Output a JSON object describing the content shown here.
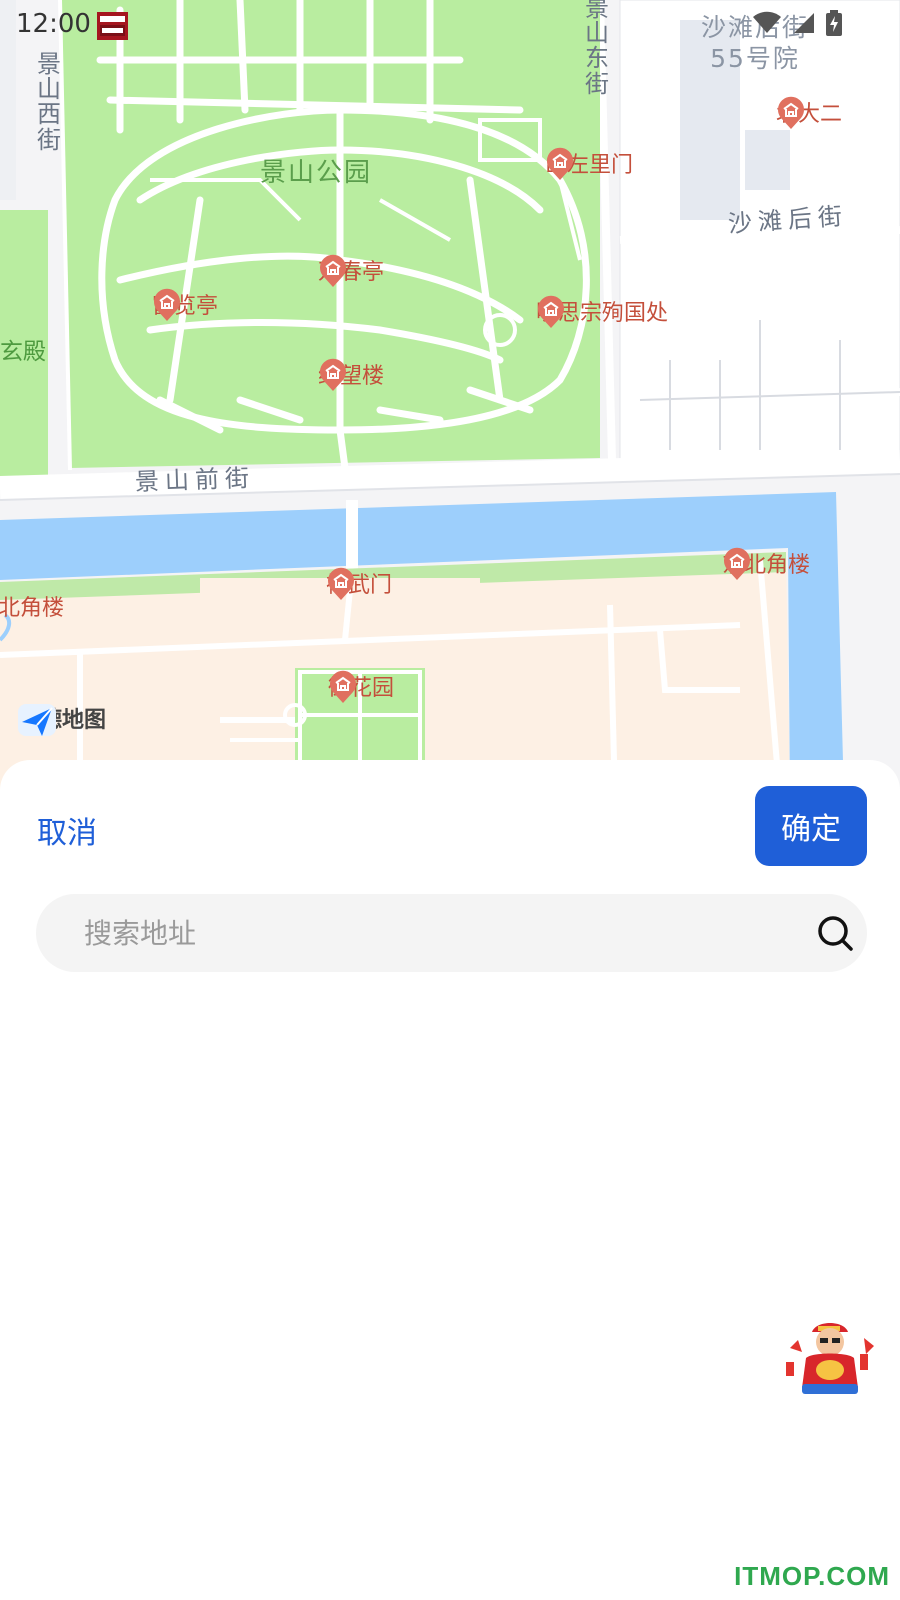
{
  "status_bar": {
    "time": "12:00",
    "notification_icon": "app-notification-icon",
    "wifi_icon": "wifi-icon",
    "signal_icon": "signal-icon",
    "battery_icon": "battery-charging-icon"
  },
  "map": {
    "provider_logo_text": "高德地图",
    "park_label": "景山公园",
    "streets": {
      "jingshan_west": "景山西街",
      "jingshan_east": "景山东街",
      "jingshan_front": "景山前街",
      "shatan_back": "沙滩后街"
    },
    "address_label": "沙滩后街\n55号院",
    "green_label": "玄殿",
    "pois": [
      {
        "name": "万春亭"
      },
      {
        "name": "富览亭"
      },
      {
        "name": "绮望楼"
      },
      {
        "name": "山左里门"
      },
      {
        "name": "明思宗殉国处"
      },
      {
        "name": "北大二"
      },
      {
        "name": "神武门"
      },
      {
        "name": "东北角楼"
      },
      {
        "name": "北角楼"
      },
      {
        "name": "御花园"
      }
    ],
    "colors": {
      "park_green": "#b9eda0",
      "water_blue": "#9dcffc",
      "palace_peach": "#fdf0e4",
      "poi_red": "#e0705f"
    }
  },
  "sheet": {
    "cancel_label": "取消",
    "confirm_label": "确定",
    "search_placeholder": "搜索地址",
    "search_value": ""
  },
  "watermark": "ITMOP.COM",
  "accent_color": "#1f5fd8"
}
